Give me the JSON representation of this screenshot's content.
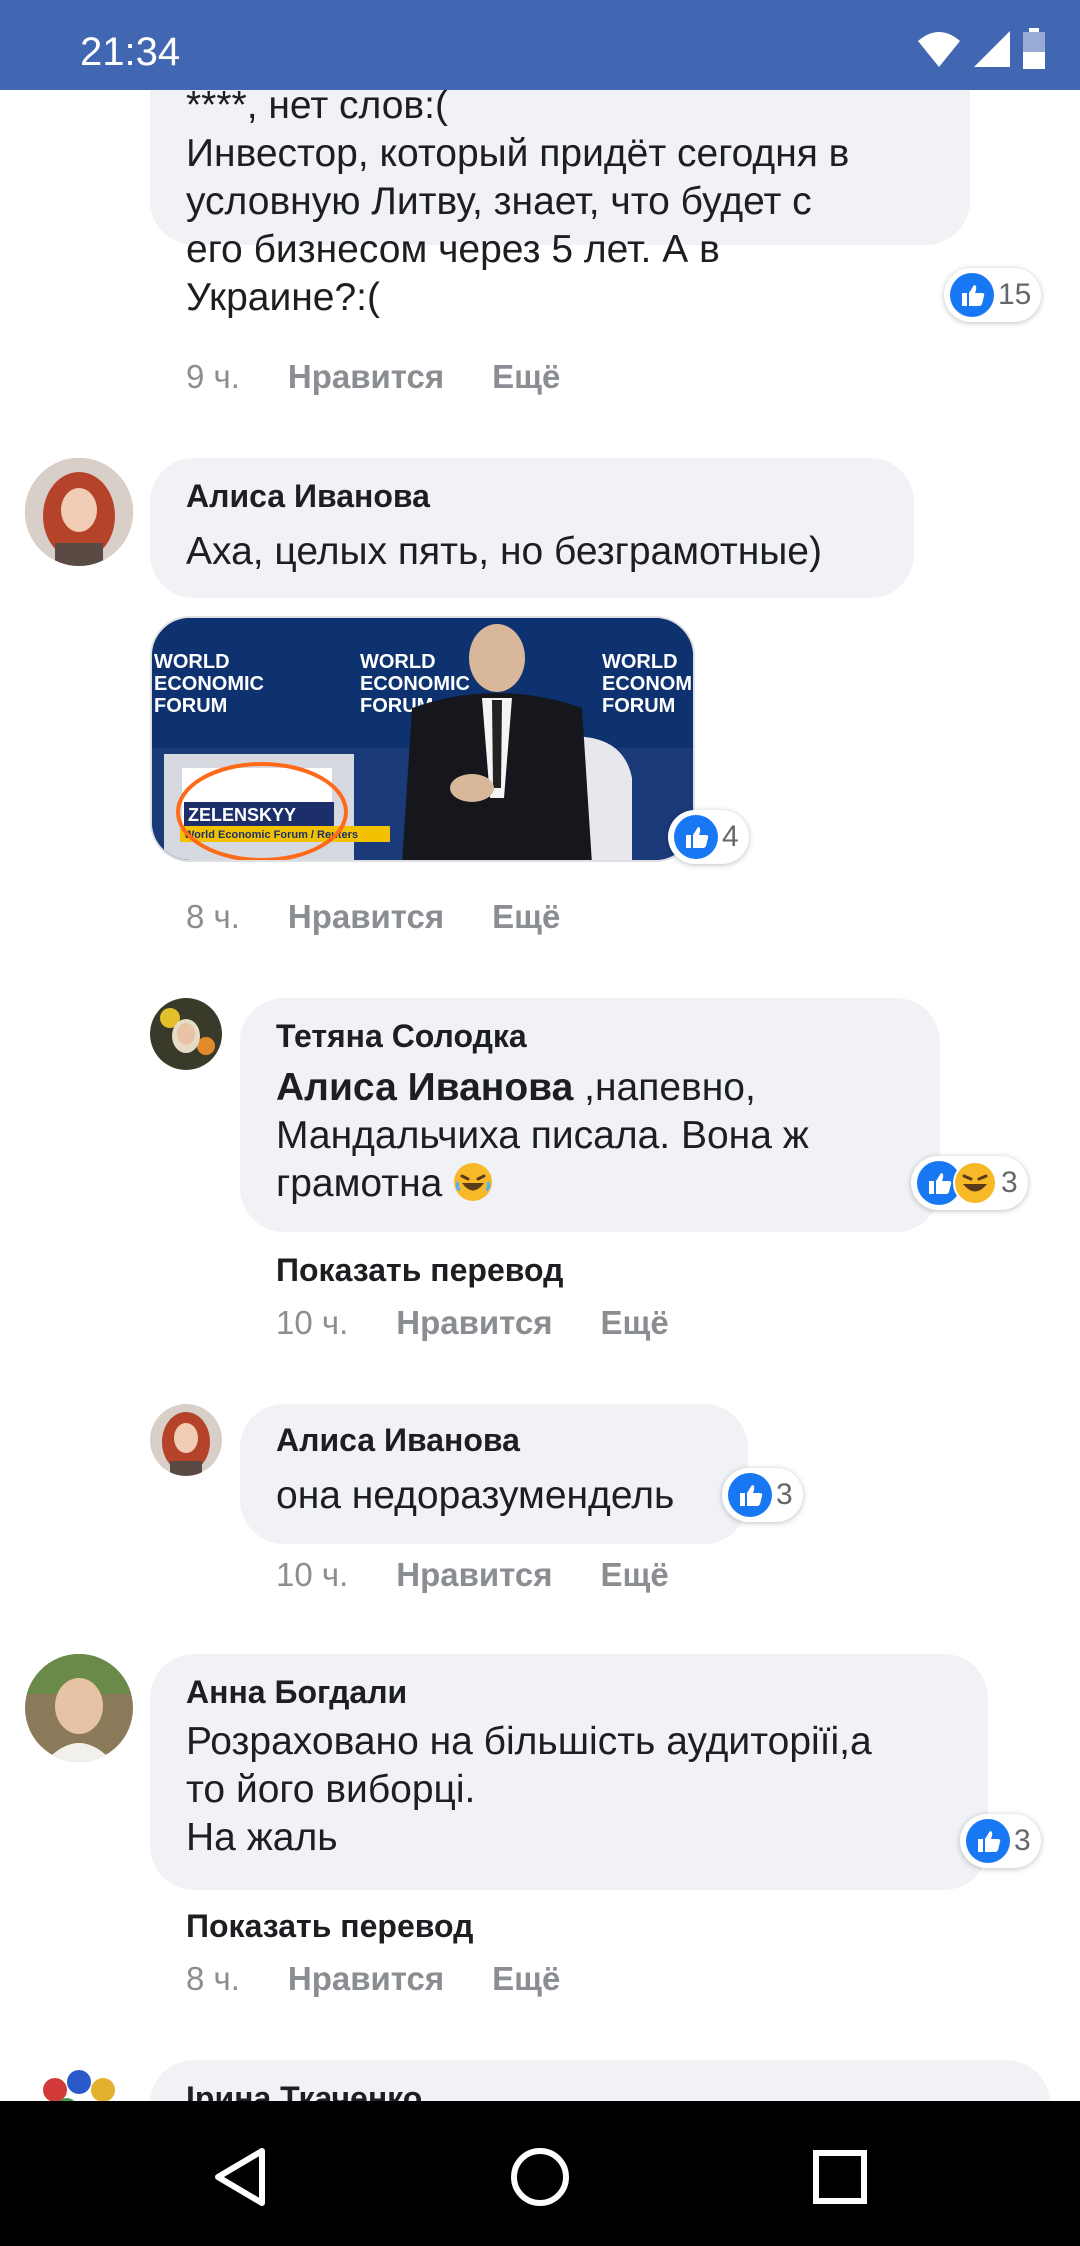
{
  "status_bar": {
    "time": "21:34"
  },
  "comments": [
    {
      "lines": [
        "****, нет слов:(",
        "Инвестор, который придёт сегодня в",
        "условную Литву, знает, что будет с",
        "его бизнесом через 5 лет. А в",
        "Украине?:("
      ],
      "reactions": {
        "count": "15",
        "icons": [
          "like-icon"
        ]
      },
      "time": "9 ч.",
      "like": "Нравится",
      "more": "Ещё"
    },
    {
      "author": "Алиса Иванова",
      "text": "Аха, целых пять, но безграмотные)",
      "image": {
        "banner_words": [
          "WORLD",
          "ECONOMIC",
          "FORUM"
        ],
        "name_plate": "ZELENSKYY",
        "credit": "World Economic Forum / Reuters"
      },
      "reactions": {
        "count": "4",
        "icons": [
          "like-icon"
        ]
      },
      "time": "8 ч.",
      "like": "Нравится",
      "more": "Ещё"
    },
    {
      "author": "Тетяна Солодка",
      "mention": "Алиса Иванова",
      "lines": [
        ",напевно,",
        "Мандальчиха писала. Вона ж",
        "грамотна"
      ],
      "reactions": {
        "count": "3",
        "icons": [
          "like-icon",
          "laugh-icon"
        ]
      },
      "translate": "Показать перевод",
      "time": "10 ч.",
      "like": "Нравится",
      "more": "Ещё"
    },
    {
      "author": "Алиса Иванова",
      "text": "она недоразумендель",
      "reactions": {
        "count": "3",
        "icons": [
          "like-icon"
        ]
      },
      "time": "10 ч.",
      "like": "Нравится",
      "more": "Ещё"
    },
    {
      "author": "Анна Богдали",
      "lines": [
        "Розраховано на більшість аудиторіїі,а",
        "то його виборці.",
        "На жаль"
      ],
      "reactions": {
        "count": "3",
        "icons": [
          "like-icon"
        ]
      },
      "translate": "Показать перевод",
      "time": "8 ч.",
      "like": "Нравится",
      "more": "Ещё"
    },
    {
      "author": "Ірина Ткаченко"
    }
  ],
  "colors": {
    "brand": "#4267b2",
    "like": "#1877f2",
    "bubble": "#f0f2f5",
    "meta": "#8a8d91"
  }
}
